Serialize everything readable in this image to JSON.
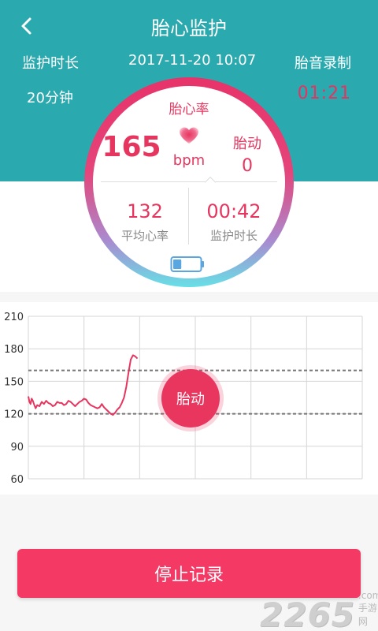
{
  "header": {
    "title": "胎心监护",
    "duration_label": "监护时长",
    "datetime": "2017-11-20 10:07",
    "record_label": "胎音录制",
    "duration_value": "20分钟",
    "record_time": "01:21"
  },
  "monitor": {
    "heart_rate_label": "胎心率",
    "heart_rate_value": "165",
    "unit": "bpm",
    "movement_label": "胎动",
    "movement_value": "0",
    "avg_value": "132",
    "avg_label": "平均心率",
    "elapsed_value": "00:42",
    "elapsed_label": "监护时长",
    "battery_level": 0.3
  },
  "chart_data": {
    "type": "line",
    "y_ticks": [
      "210",
      "180",
      "150",
      "120",
      "90",
      "60"
    ],
    "ylim": [
      60,
      210
    ],
    "reference_lines": [
      160,
      120
    ],
    "series": [
      {
        "x": [
          0,
          0.02,
          0.04,
          0.06,
          0.08,
          0.1,
          0.13,
          0.16,
          0.2,
          0.24,
          0.28,
          0.32,
          0.36,
          0.4,
          0.44,
          0.48,
          0.52,
          0.56,
          0.6,
          0.64,
          0.68,
          0.72,
          0.76,
          0.8,
          0.84,
          0.88,
          0.92,
          0.96,
          1.0,
          1.04,
          1.08,
          1.12,
          1.16,
          1.2,
          1.24,
          1.28,
          1.32,
          1.36,
          1.4,
          1.44,
          1.48,
          1.52,
          1.56,
          1.6,
          1.64,
          1.68,
          1.72,
          1.76,
          1.8,
          1.84,
          1.88,
          1.92,
          1.96
        ],
        "values": [
          136,
          131,
          129,
          134,
          132,
          129,
          125,
          128,
          127,
          131,
          129,
          132,
          130,
          129,
          127,
          128,
          131,
          130,
          130,
          128,
          129,
          132,
          131,
          129,
          127,
          129,
          131,
          132,
          134,
          133,
          130,
          128,
          127,
          126,
          125,
          126,
          129,
          126,
          124,
          122,
          120,
          119,
          121,
          124,
          126,
          130,
          135,
          145,
          158,
          170,
          174,
          173,
          171
        ]
      }
    ]
  },
  "fetal_movement_button": "胎动",
  "stop_button": "停止记录",
  "watermark": {
    "number": "2265",
    "sub": ".com 手游网"
  },
  "colors": {
    "teal": "#2aaaae",
    "pink": "#e6365f",
    "button": "#f43a64"
  }
}
